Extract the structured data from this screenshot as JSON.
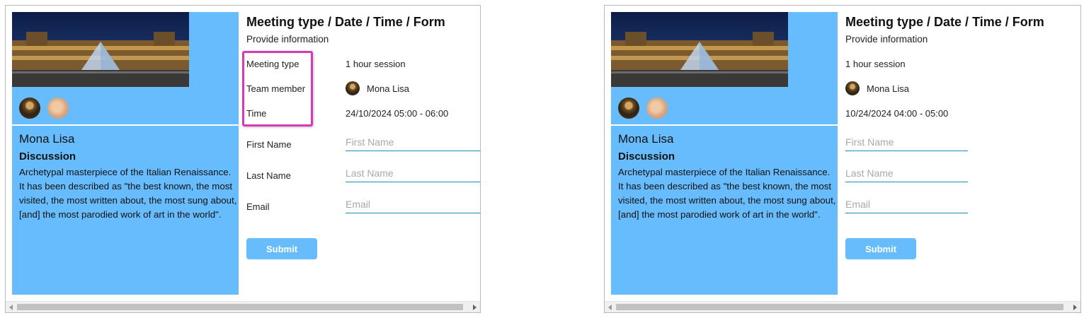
{
  "panels": [
    {
      "title_parts": [
        "Meeting type",
        "Date",
        "Time",
        "Form"
      ],
      "title_separator": "/",
      "subtitle": "Provide information",
      "host": {
        "name": "Mona Lisa",
        "topic": "Discussion",
        "description": "Archetypal masterpiece of the Italian Renaissance. It has been described as \"the best known, the most visited, the most written about, the most sung about, [and] the most parodied work of art in the world\"."
      },
      "info": {
        "meeting_type_label": "Meeting type",
        "meeting_type_value": "1 hour session",
        "team_member_label": "Team member",
        "team_member_value": "Mona Lisa",
        "time_label": "Time",
        "time_value": "24/10/2024 05:00 - 06:00"
      },
      "form": {
        "first_name_label": "First Name",
        "first_name_placeholder": "First Name",
        "last_name_label": "Last Name",
        "last_name_placeholder": "Last Name",
        "email_label": "Email",
        "email_placeholder": "Email",
        "submit_label": "Submit"
      }
    },
    {
      "title_parts": [
        "Meeting type",
        "Date",
        "Time",
        "Form"
      ],
      "title_separator": "/",
      "subtitle": "Provide information",
      "host": {
        "name": "Mona Lisa",
        "topic": "Discussion",
        "description": "Archetypal masterpiece of the Italian Renaissance. It has been described as \"the best known, the most visited, the most written about, the most sung about, [and] the most parodied work of art in the world\"."
      },
      "info": {
        "meeting_type_value": "1 hour session",
        "team_member_value": "Mona Lisa",
        "time_value": "10/24/2024 04:00 - 05:00"
      },
      "form": {
        "first_name_placeholder": "First Name",
        "last_name_placeholder": "Last Name",
        "email_placeholder": "Email",
        "submit_label": "Submit"
      }
    }
  ],
  "colors": {
    "panel_blue": "#66bcfd",
    "input_underline": "#1f8fb3",
    "highlight_magenta": "#d63ab5"
  },
  "icons": [
    "louvre-photo",
    "mona-lisa-avatar",
    "tan-avatar",
    "scroll-left-icon",
    "scroll-right-icon"
  ]
}
